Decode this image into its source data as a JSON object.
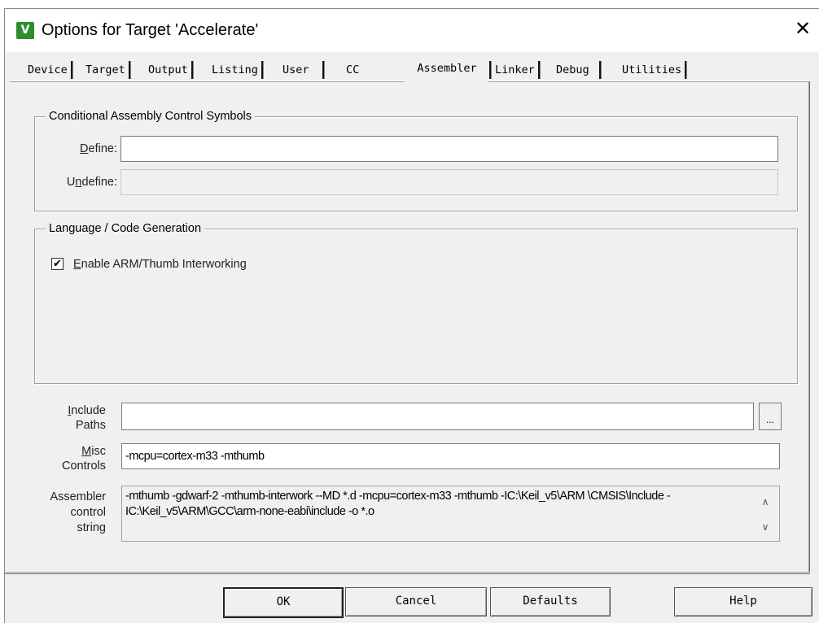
{
  "window": {
    "title": "Options for Target 'Accelerate'",
    "close_glyph": "✕",
    "icon_glyph": "V"
  },
  "tabs": [
    {
      "label": "Device",
      "active": false
    },
    {
      "label": "Target",
      "active": false
    },
    {
      "label": "Output",
      "active": false
    },
    {
      "label": "Listing",
      "active": false
    },
    {
      "label": "User",
      "active": false
    },
    {
      "label": "CC",
      "active": false
    },
    {
      "label": "Assembler",
      "active": true
    },
    {
      "label": "Linker",
      "active": false
    },
    {
      "label": "Debug",
      "active": false
    },
    {
      "label": "Utilities",
      "active": false
    }
  ],
  "conditional": {
    "title": "Conditional Assembly Control Symbols",
    "define_label_u": "D",
    "define_label_rest": "efine:",
    "define_value": "",
    "undefine_label_pre": "U",
    "undefine_label_u": "n",
    "undefine_label_rest": "define:",
    "undefine_value": ""
  },
  "language": {
    "title": "Language / Code Generation",
    "interwork_checked": true,
    "check_glyph": "✔",
    "interwork_label_u": "E",
    "interwork_label_rest": "nable ARM/Thumb Interworking"
  },
  "include": {
    "label_line1_u": "I",
    "label_line1_rest": "nclude",
    "label_line2": "Paths",
    "value": "",
    "browse_label": "..."
  },
  "misc": {
    "label_line1_u": "M",
    "label_line1_rest": "isc",
    "label_line2": "Controls",
    "value": "-mcpu=cortex-m33 -mthumb"
  },
  "assembler_string": {
    "label_line1": "Assembler",
    "label_line2": "control",
    "label_line3": "string",
    "value": "-mthumb -gdwarf-2 -mthumb-interwork --MD *.d -mcpu=cortex-m33 -mthumb -IC:\\Keil_v5\\ARM \\CMSIS\\Include -IC:\\Keil_v5\\ARM\\GCC\\arm-none-eabi\\include -o *.o",
    "scroll_up_glyph": "∧",
    "scroll_down_glyph": "∨"
  },
  "buttons": {
    "ok": "OK",
    "cancel": "Cancel",
    "defaults": "Defaults",
    "help": "Help"
  }
}
